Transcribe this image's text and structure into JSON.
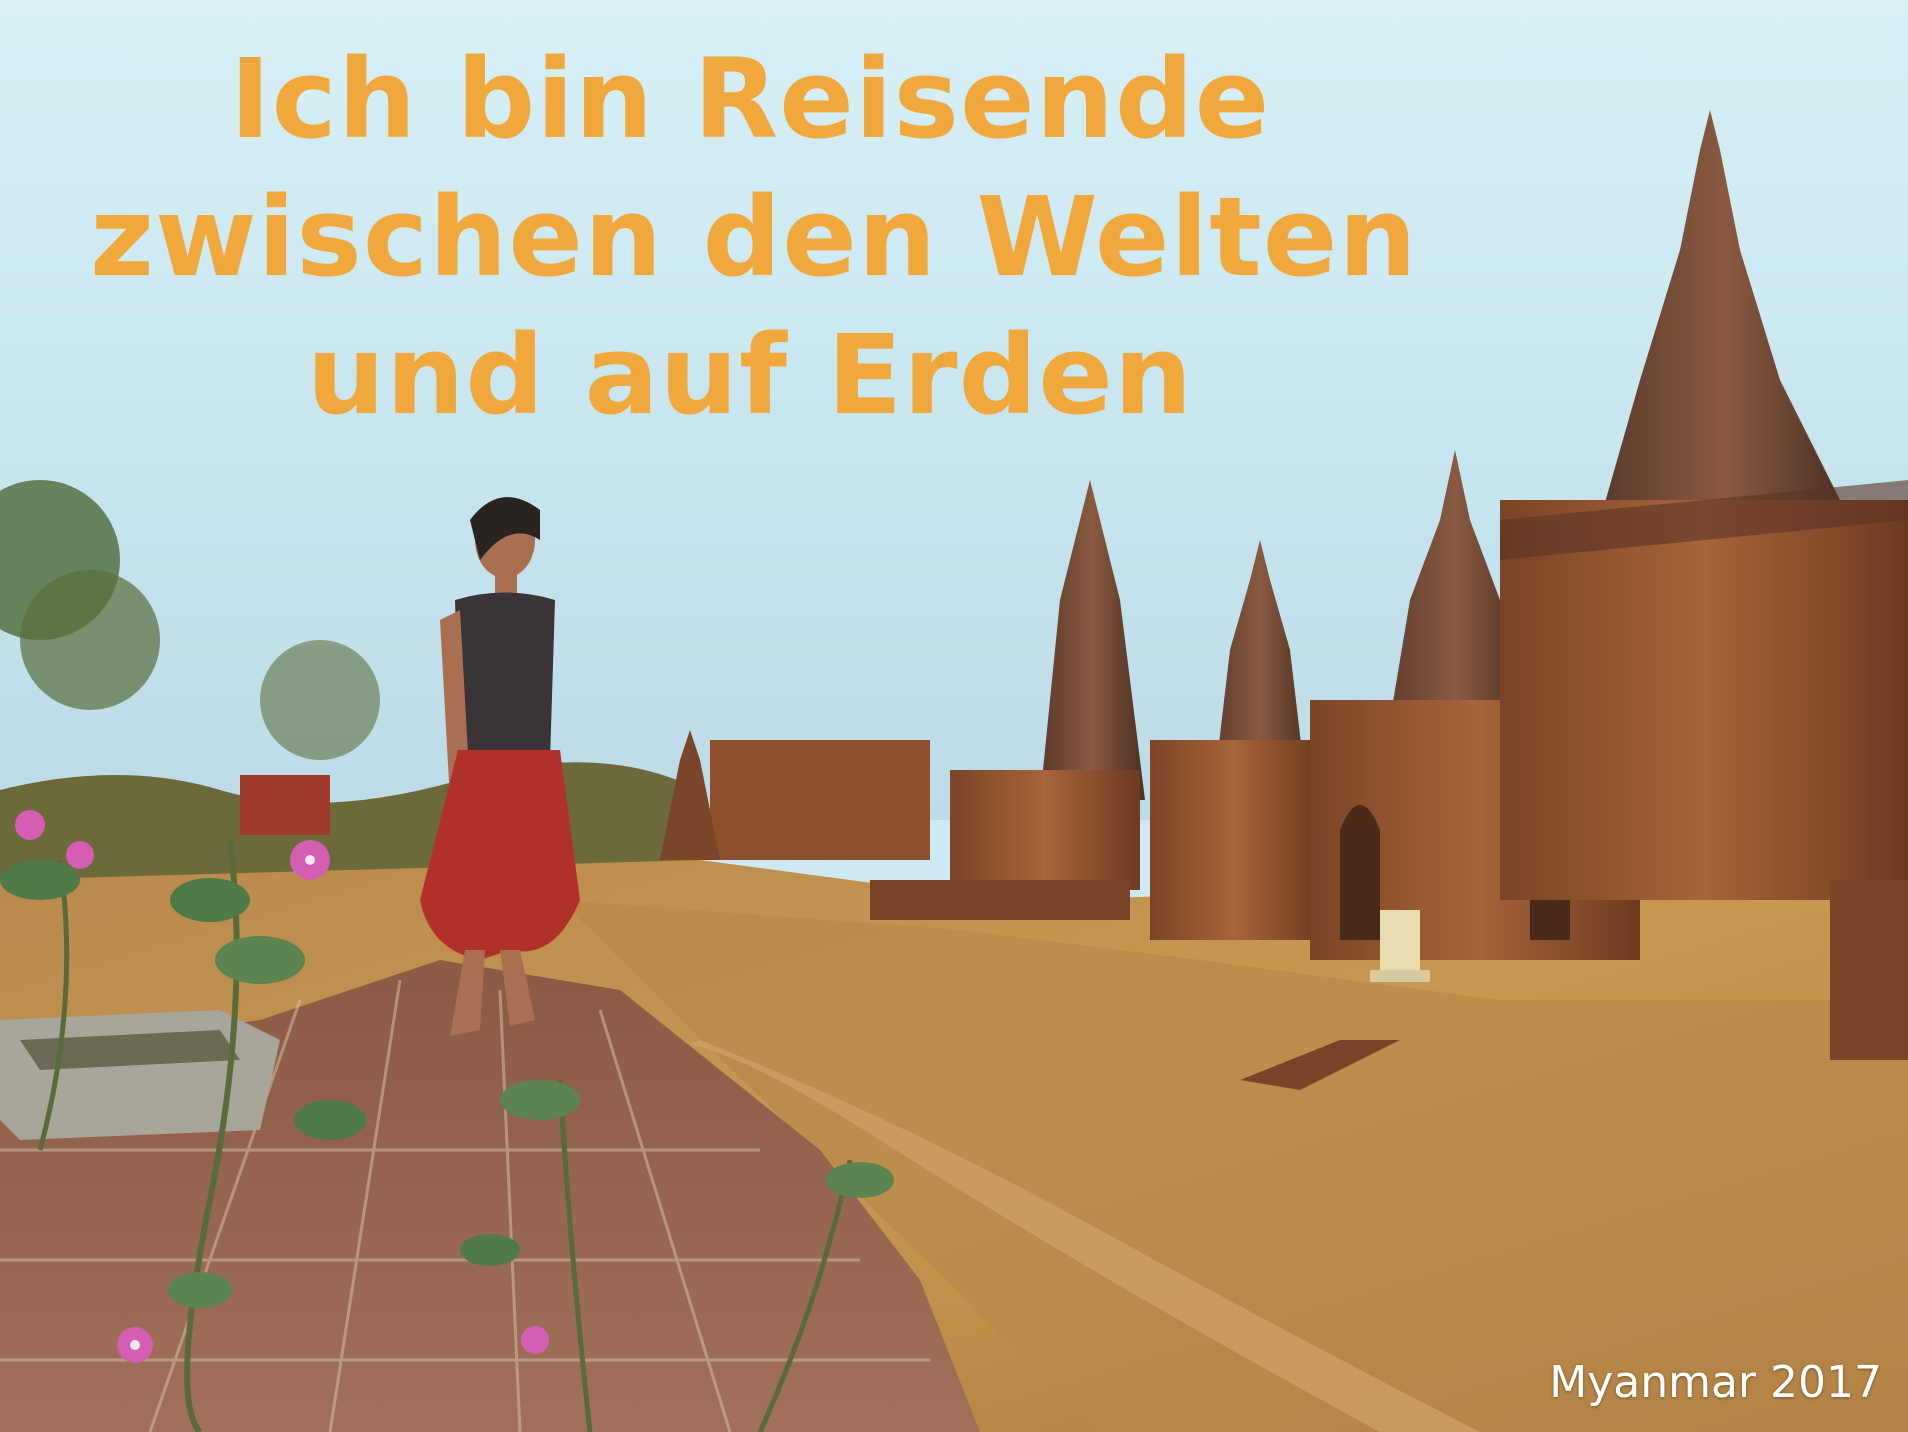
{
  "headline": {
    "line1": "Ich bin Reisende",
    "line2": "zwischen den Welten",
    "line3": "und auf Erden"
  },
  "caption": "Myanmar 2017",
  "colors": {
    "headline_text": "#f0a83c",
    "caption_text": "#ffffff",
    "sky": "#cfe9f2",
    "brick": "#9a5a33",
    "skirt": "#b0302a"
  }
}
